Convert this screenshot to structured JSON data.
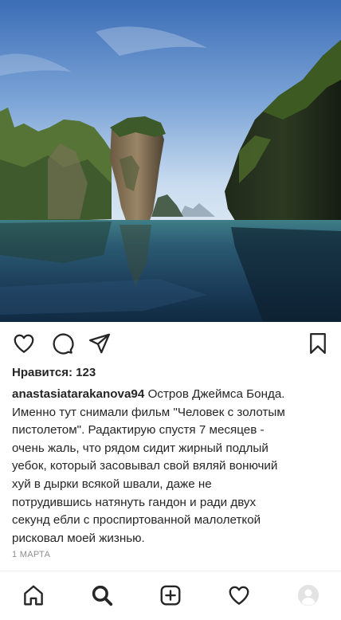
{
  "post": {
    "likes_label": "Нравится: 123",
    "username": "anastasiatarakanova94",
    "caption_lines": [
      " Остров Джеймса Бонда.",
      "Именно тут снимали фильм \"Человек с золотым",
      "пистолетом\". Радактирую спустя 7 месяцев -",
      "очень жаль, что рядом сидит жирный подлый",
      "уебок, который засовывал свой вяляй  вонючий",
      "хуй в дырки  всякой швали, даже не",
      "потрудившись натянуть  гандон и ради двух",
      "секунд ебли  с проспиртованной малолеткой",
      "рисковал моей жизнью."
    ],
    "date": "1 МАРТА"
  },
  "actions": {
    "like_icon": "heart-icon",
    "comment_icon": "comment-icon",
    "share_icon": "send-icon",
    "save_icon": "bookmark-icon"
  },
  "tabbar": {
    "items": [
      "home-icon",
      "search-icon",
      "add-post-icon",
      "activity-heart-icon",
      "profile-avatar"
    ]
  },
  "colors": {
    "text": "#262626",
    "muted": "#8e8e8e",
    "sky_top": "#3d6fb8",
    "water": "#17354f"
  }
}
